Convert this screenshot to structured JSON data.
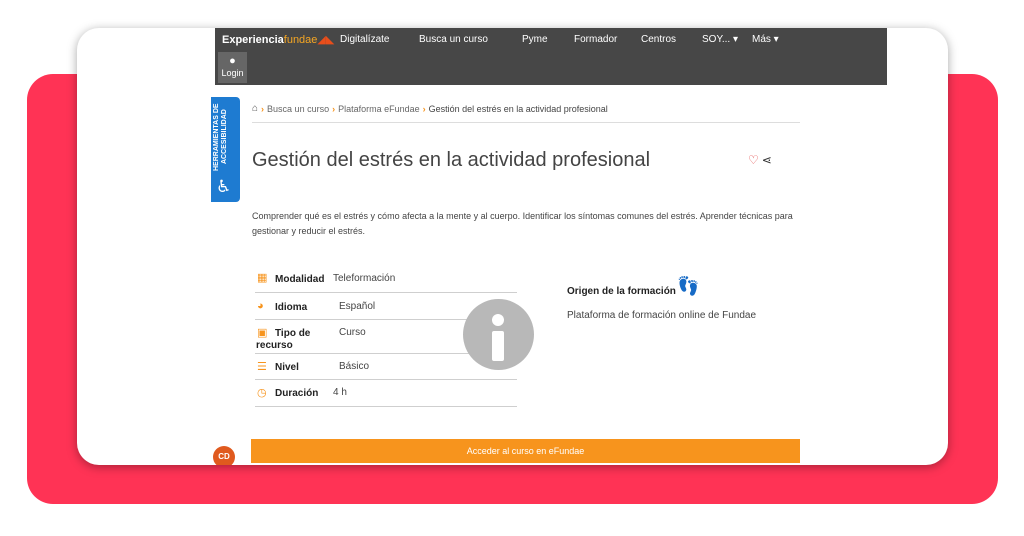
{
  "nav": {
    "logo_text": "Experiencia",
    "logo_sub": "fundae",
    "links": [
      "Digitalízate",
      "Busca un curso",
      "Pyme",
      "Formador",
      "Centros",
      "SOY... ▾",
      "Más ▾"
    ],
    "login_label": "Login"
  },
  "accessibility": {
    "label": "HERRAMIENTAS DE ACCESIBILIDAD"
  },
  "breadcrumb": {
    "items": [
      "Busca un curso",
      "Plataforma eFundae",
      "Gestión del estrés en la actividad profesional"
    ]
  },
  "course": {
    "title": "Gestión del estrés en la actividad profesional",
    "description": "Comprender qué es el estrés y cómo afecta a la mente y al cuerpo. Identificar los síntomas comunes del estrés. Aprender técnicas para gestionar y reducir el estrés.",
    "details": [
      {
        "label": "Modalidad",
        "value": "Teleformación",
        "icon": "map-icon"
      },
      {
        "label": "Idioma",
        "value": "Español",
        "icon": "language-icon"
      },
      {
        "label": "Tipo de recurso",
        "value": "Curso",
        "icon": "image-icon"
      },
      {
        "label": "Nivel",
        "value": "Básico",
        "icon": "list-level-icon"
      },
      {
        "label": "Duración",
        "value": "4 h",
        "icon": "clock-icon"
      }
    ],
    "origin_title": "Origen de la formación",
    "origin_value": "Plataforma de formación online de Fundae",
    "access_button": "Acceder al curso en eFundae"
  },
  "badge": {
    "label": "CD"
  },
  "colors": {
    "accent": "#f7941d",
    "nav_bg": "#474747",
    "frame": "#ff3355",
    "a11y": "#1e7bd1"
  }
}
